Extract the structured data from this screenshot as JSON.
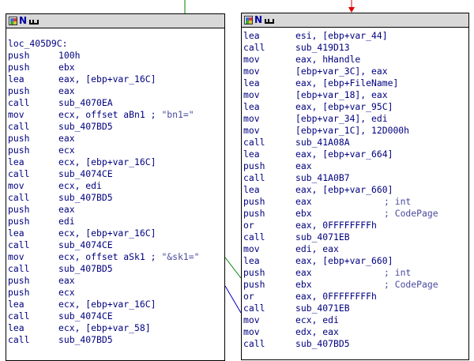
{
  "left_block": {
    "rows": [
      {
        "type": "gap"
      },
      {
        "type": "label",
        "text": "loc_405D9C:"
      },
      {
        "mn": "push",
        "op": "100h"
      },
      {
        "mn": "push",
        "op": "ebx"
      },
      {
        "mn": "lea",
        "op": "eax, [ebp+var_16C]"
      },
      {
        "mn": "push",
        "op": "eax"
      },
      {
        "mn": "call",
        "op": "sub_4070EA"
      },
      {
        "mn": "mov",
        "op": "ecx, offset aBn1 ;",
        "cm": "\"bn1=\""
      },
      {
        "mn": "call",
        "op": "sub_407BD5"
      },
      {
        "mn": "push",
        "op": "eax"
      },
      {
        "mn": "push",
        "op": "ecx"
      },
      {
        "mn": "lea",
        "op": "ecx, [ebp+var_16C]"
      },
      {
        "mn": "call",
        "op": "sub_4074CE"
      },
      {
        "mn": "mov",
        "op": "ecx, edi"
      },
      {
        "mn": "call",
        "op": "sub_407BD5"
      },
      {
        "mn": "push",
        "op": "eax"
      },
      {
        "mn": "push",
        "op": "edi"
      },
      {
        "mn": "lea",
        "op": "ecx, [ebp+var_16C]"
      },
      {
        "mn": "call",
        "op": "sub_4074CE"
      },
      {
        "mn": "mov",
        "op": "ecx, offset aSk1 ;",
        "cm": "\"&sk1=\""
      },
      {
        "mn": "call",
        "op": "sub_407BD5"
      },
      {
        "mn": "push",
        "op": "eax"
      },
      {
        "mn": "push",
        "op": "ecx"
      },
      {
        "mn": "lea",
        "op": "ecx, [ebp+var_16C]"
      },
      {
        "mn": "call",
        "op": "sub_4074CE"
      },
      {
        "mn": "lea",
        "op": "ecx, [ebp+var_58]"
      },
      {
        "mn": "call",
        "op": "sub_407BD5"
      }
    ]
  },
  "right_block": {
    "rows": [
      {
        "mn": "lea",
        "op": "esi, [ebp+var_44]"
      },
      {
        "mn": "call",
        "op": "sub_419D13"
      },
      {
        "mn": "mov",
        "op": "eax, hHandle"
      },
      {
        "mn": "mov",
        "op": "[ebp+var_3C], eax"
      },
      {
        "mn": "lea",
        "op": "eax, [ebp+FileName]"
      },
      {
        "mn": "mov",
        "op": "[ebp+var_18], eax"
      },
      {
        "mn": "lea",
        "op": "eax, [ebp+var_95C]"
      },
      {
        "mn": "mov",
        "op": "[ebp+var_34], edi"
      },
      {
        "mn": "mov",
        "op": "[ebp+var_1C], 12D000h"
      },
      {
        "mn": "call",
        "op": "sub_41A08A"
      },
      {
        "mn": "lea",
        "op": "eax, [ebp+var_664]"
      },
      {
        "mn": "push",
        "op": "eax"
      },
      {
        "mn": "call",
        "op": "sub_41A0B7"
      },
      {
        "mn": "lea",
        "op": "eax, [ebp+var_660]"
      },
      {
        "mn": "push",
        "op": "eax",
        "cm": "; int"
      },
      {
        "mn": "push",
        "op": "ebx",
        "cm": "; CodePage"
      },
      {
        "mn": "or",
        "op": "eax, 0FFFFFFFFh"
      },
      {
        "mn": "call",
        "op": "sub_4071EB"
      },
      {
        "mn": "mov",
        "op": "edi, eax"
      },
      {
        "mn": "lea",
        "op": "eax, [ebp+var_660]"
      },
      {
        "mn": "push",
        "op": "eax",
        "cm": "; int"
      },
      {
        "mn": "push",
        "op": "ebx",
        "cm": "; CodePage"
      },
      {
        "mn": "or",
        "op": "eax, 0FFFFFFFFh"
      },
      {
        "mn": "call",
        "op": "sub_4071EB"
      },
      {
        "mn": "mov",
        "op": "ecx, edi"
      },
      {
        "mn": "mov",
        "op": "edx, eax"
      },
      {
        "mn": "call",
        "op": "sub_407BD5"
      }
    ]
  },
  "colors": {
    "text": "#000080",
    "header": "#d8d8d8",
    "green_edge": "#008000",
    "red_edge": "#e00000",
    "blue_edge": "#0000c0"
  }
}
